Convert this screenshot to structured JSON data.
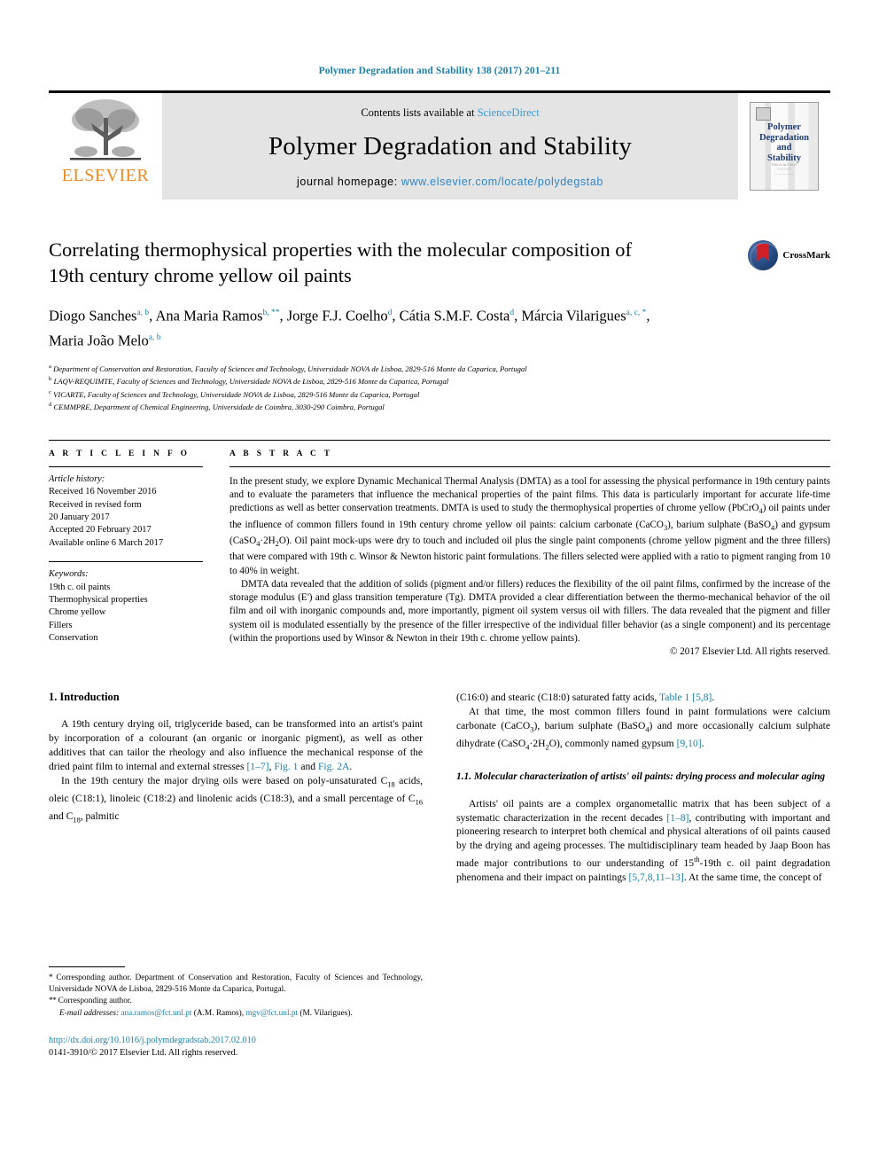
{
  "running_head": "Polymer Degradation and Stability 138 (2017) 201–211",
  "masthead": {
    "publisher_name": "ELSEVIER",
    "contents_prefix": "Contents lists available at ",
    "contents_link": "ScienceDirect",
    "journal_title": "Polymer Degradation and Stability",
    "homepage_prefix": "journal homepage: ",
    "homepage_url": "www.elsevier.com/locate/polydegstab",
    "cover": {
      "title_lines": [
        "Polymer",
        "Degradation",
        "and",
        "Stability"
      ],
      "footer_lines": [
        "Editor-in-Chief",
        "○○○○○○",
        "—————"
      ]
    }
  },
  "article": {
    "title": "Correlating thermophysical properties with the molecular composition of 19th century chrome yellow oil paints",
    "crossmark_label": "CrossMark",
    "authors": [
      {
        "name": "Diogo Sanches",
        "marks": "a, b",
        "sep": ", "
      },
      {
        "name": "Ana Maria Ramos",
        "marks": "b, **",
        "sep": ", "
      },
      {
        "name": "Jorge F.J. Coelho",
        "marks": "d",
        "sep": ", "
      },
      {
        "name": "Cátia S.M.F. Costa",
        "marks": "d",
        "sep": ", "
      },
      {
        "name": "Márcia Vilarigues",
        "marks": "a, c, *",
        "sep": ", "
      },
      {
        "name": "Maria João Melo",
        "marks": "a, b",
        "sep": ""
      }
    ],
    "affiliations": [
      {
        "mark": "a",
        "text": "Department of Conservation and Restoration, Faculty of Sciences and Technology, Universidade NOVA de Lisboa, 2829-516 Monte da Caparica, Portugal"
      },
      {
        "mark": "b",
        "text": "LAQV-REQUIMTE, Faculty of Sciences and Technology, Universidade NOVA de Lisboa, 2829-516 Monte da Caparica, Portugal"
      },
      {
        "mark": "c",
        "text": "VICARTE, Faculty of Sciences and Technology, Universidade NOVA de Lisboa, 2829-516 Monte da Caparica, Portugal"
      },
      {
        "mark": "d",
        "text": "CEMMPRE, Department of Chemical Engineering, Universidade de Coimbra, 3030-290 Coimbra, Portugal"
      }
    ]
  },
  "article_info": {
    "heading": "A R T I C L E  I N F O",
    "history_label": "Article history:",
    "history": [
      "Received 16 November 2016",
      "Received in revised form",
      "20 January 2017",
      "Accepted 20 February 2017",
      "Available online 6 March 2017"
    ],
    "keywords_label": "Keywords:",
    "keywords": [
      "19th c. oil paints",
      "Thermophysical properties",
      "Chrome yellow",
      "Fillers",
      "Conservation"
    ]
  },
  "abstract": {
    "heading": "A B S T R A C T",
    "paragraph1_a": "In the present study, we explore Dynamic Mechanical Thermal Analysis (DMTA) as a tool for assessing the physical performance in 19th century paints and to evaluate the parameters that influence the mechanical properties of the paint films. This data is particularly important for accurate life-time predictions as well as better conservation treatments. DMTA is used to study the thermophysical properties of chrome yellow (PbCrO",
    "paragraph1_b": ") oil paints under the influence of common fillers found in 19th century chrome yellow oil paints: calcium carbonate (CaCO",
    "paragraph1_c": "), barium sulphate (BaSO",
    "paragraph1_d": ") and gypsum (CaSO",
    "paragraph1_e": "·2H",
    "paragraph1_f": "O). Oil paint mock-ups were dry to touch and included oil plus the single paint components (chrome yellow pigment and the three fillers) that were compared with 19th c. Winsor & Newton historic paint formulations. The fillers selected were applied with a ratio to pigment ranging from 10 to 40% in weight.",
    "paragraph2": "DMTA data revealed that the addition of solids (pigment and/or fillers) reduces the flexibility of the oil paint films, confirmed by the increase of the storage modulus (E') and glass transition temperature (Tg). DMTA provided a clear differentiation between the thermo-mechanical behavior of the oil film and oil with inorganic compounds and, more importantly, pigment oil system versus oil with fillers. The data revealed that the pigment and filler system oil is modulated essentially by the presence of the filler irrespective of the individual filler behavior (as a single component) and its percentage (within the proportions used by Winsor & Newton in their 19th c. chrome yellow paints).",
    "copyright": "© 2017 Elsevier Ltd. All rights reserved."
  },
  "body": {
    "section1_title": "1. Introduction",
    "left_p1_a": "A 19th century drying oil, triglyceride based, can be transformed into an artist's paint by incorporation of a colourant (an organic or inorganic pigment), as well as other additives that can tailor the rheology and also influence the mechanical response of the dried paint film to internal and external stresses ",
    "left_p1_ref1": "[1–7]",
    "left_p1_mid": ", ",
    "left_p1_ref2": "Fig. 1",
    "left_p1_mid2": " and ",
    "left_p1_ref3": "Fig. 2A",
    "left_p1_end": ".",
    "left_p2_a": "In the 19th century the major drying oils were based on poly-unsaturated C",
    "left_p2_sub1": "18",
    "left_p2_b": " acids, oleic (C18:1), linoleic (C18:2) and linolenic acids (C18:3), and a small percentage of C",
    "left_p2_sub2": "16",
    "left_p2_c": " and C",
    "left_p2_sub3": "18",
    "left_p2_d": ", palmitic",
    "right_p1_a": "(C16:0) and stearic (C18:0) saturated fatty acids, ",
    "right_p1_ref": "Table 1 [5,8]",
    "right_p1_b": ".",
    "right_p2_a": "At that time, the most common fillers found in paint formulations were calcium carbonate (CaCO",
    "right_p2_b": "), barium sulphate (BaSO",
    "right_p2_c": ") and more occasionally calcium sulphate dihydrate (CaSO",
    "right_p2_d": "·2H",
    "right_p2_e": "O), commonly named gypsum ",
    "right_p2_ref": "[9,10]",
    "right_p2_f": ".",
    "subsection_title": "1.1. Molecular characterization of artists' oil paints: drying process and molecular aging",
    "right_p3_a": "Artists' oil paints are a complex organometallic matrix that has been subject of a systematic characterization in the recent decades ",
    "right_p3_ref1": "[1–8]",
    "right_p3_b": ", contributing with important and pioneering research to interpret both chemical and physical alterations of oil paints caused by the drying and ageing processes. The multidisciplinary team headed by Jaap Boon has made major contributions to our understanding of 15",
    "right_p3_sup": "th",
    "right_p3_c": "-19th c. oil paint degradation phenomena and their impact on paintings ",
    "right_p3_ref2": "[5,7,8,11–13]",
    "right_p3_d": ". At the same time, the concept of"
  },
  "footnotes": {
    "star_mark": "*",
    "star_text": " Corresponding author. Department of Conservation and Restoration, Faculty of Sciences and Technology, Universidade NOVA de Lisboa, 2829-516 Monte da Caparica, Portugal.",
    "dstar_mark": "**",
    "dstar_text": " Corresponding author.",
    "email_label": "E-mail addresses:",
    "email1": "ana.ramos@fct.unl.pt",
    "email1_owner": " (A.M. Ramos), ",
    "email2": "mgv@fct.unl.pt",
    "email2_owner": " (M. Vilarigues).",
    "doi": "http://dx.doi.org/10.1016/j.polymdegradstab.2017.02.010",
    "issn": "0141-3910/© 2017 Elsevier Ltd. All rights reserved."
  },
  "colors": {
    "link": "#1b7fa8",
    "elsevier_orange": "#f08921",
    "masthead_bg": "#e4e4e4",
    "cover_blue": "#1f3b73"
  }
}
